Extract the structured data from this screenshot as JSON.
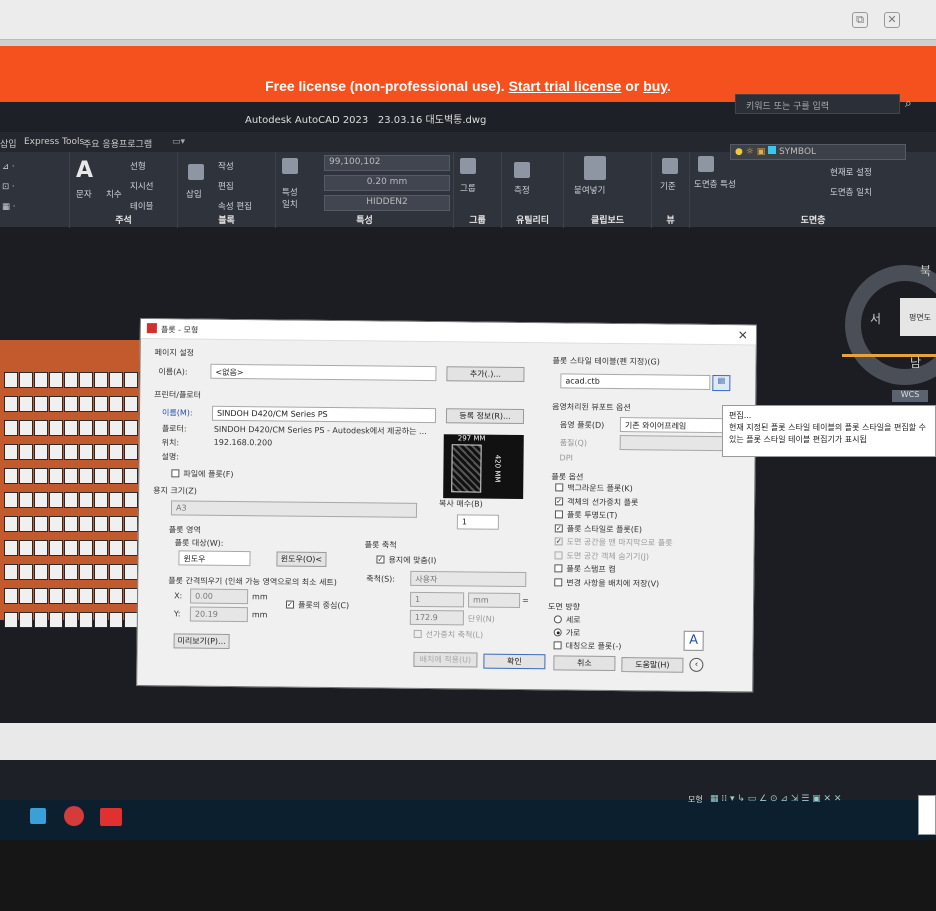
{
  "banner": {
    "prefix": "Free license (non-professional use). ",
    "trial": "Start trial license",
    "or": " or ",
    "buy": "buy",
    "suffix": "."
  },
  "app": {
    "title": "Autodesk AutoCAD 2023",
    "file": "23.03.16 대도벽통.dwg",
    "search_placeholder": "키워드 또는 구를 입력"
  },
  "ribbon_tabs": [
    "삽입",
    "Express Tools",
    "주요 응용프로그램"
  ],
  "ribbon": {
    "annotate_label": "주석",
    "annotate_items": [
      "문자",
      "치수",
      "선형",
      "지시선",
      "테이블"
    ],
    "block_label": "블록",
    "block_items": [
      "삽입",
      "작성",
      "편집",
      "속성 편집"
    ],
    "properties_label": "특성",
    "prop_color": "99,100,102",
    "prop_lineweight": "0.20 mm",
    "prop_linetype": "HIDDEN2",
    "prop_items": [
      "특성",
      "일치"
    ],
    "group_label": "그룹",
    "group_item": "그룹",
    "utility_label": "유틸리티",
    "utility_item": "측정",
    "clipboard_label": "클립보드",
    "clipboard_item": "붙여넣기",
    "view_label": "뷰",
    "view_item": "기준",
    "layer_label": "도면층",
    "layer_name": "SYMBOL",
    "layer_items": [
      "도면층 특성",
      "현재로 설정",
      "도면층 일치"
    ]
  },
  "viewcube": {
    "west": "서",
    "south": "남",
    "north": "북",
    "face": "평면도",
    "wcs": "WCS"
  },
  "status_right": "모형",
  "dialog": {
    "title": "플롯 - 모형",
    "page_setup": {
      "section": "페이지 설정",
      "name_label": "이름(A):",
      "name_value": "<없음>",
      "add_button": "추가(.)..."
    },
    "printer": {
      "section": "프린터/플로터",
      "name_label": "이름(M):",
      "name_value": "SINDOH D420/CM Series PS",
      "properties_button": "등록 정보(R)...",
      "plotter_label": "플로터:",
      "plotter_value": "SINDOH D420/CM Series PS - Autodesk에서 제공하는 ...",
      "where_label": "위치:",
      "where_value": "192.168.0.200",
      "desc_label": "설명:",
      "plot_to_file": "파일에 플롯(F)",
      "preview_width": "297 MM",
      "preview_height": "420 MM"
    },
    "paper": {
      "section": "용지 크기(Z)",
      "value": "A3"
    },
    "copies": {
      "label": "복사 매수(B)",
      "value": "1"
    },
    "area": {
      "section": "플롯 영역",
      "what_label": "플롯 대상(W):",
      "what_value": "윈도우",
      "window_button": "윈도우(O)<"
    },
    "offset": {
      "section": "플롯 간격띄우기 (인쇄 가능 영역으로의 최소 세트)",
      "x_label": "X:",
      "x_value": "0.00",
      "x_unit": "mm",
      "y_label": "Y:",
      "y_value": "20.19",
      "y_unit": "mm",
      "center": "플롯의 중심(C)"
    },
    "scale": {
      "section": "플롯 축척",
      "fit": "용지에 맞춤(I)",
      "scale_label": "축척(S):",
      "scale_value": "사용자",
      "v1": "1",
      "unit": "mm",
      "eq": "=",
      "v2": "172.9",
      "unit2": "단위(N)",
      "lw": "선가중치 축척(L)"
    },
    "plot_style": {
      "section": "플롯 스타일 테이블(펜 지정)(G)",
      "value": "acad.ctb"
    },
    "shaded": {
      "section": "음영처리된 뷰포트 옵션",
      "shade_label": "음영 플롯(D)",
      "shade_value": "기존 와이어프레임",
      "quality_label": "품질(Q)",
      "dpi_label": "DPI"
    },
    "options": {
      "section": "플롯 옵션",
      "items": [
        "백그라운드 플롯(K)",
        "객체의 선가중치 플롯",
        "플롯 투명도(T)",
        "플롯 스타일로 플롯(E)",
        "도면 공간을 맨 마지막으로 플롯",
        "도면 공간 객체 숨기기(J)",
        "플롯 스탬프 켬",
        "변경 사항을 배치에 저장(V)"
      ],
      "checked": [
        false,
        true,
        false,
        true,
        true,
        false,
        false,
        false
      ]
    },
    "orientation": {
      "section": "도면 방향",
      "portrait": "세로",
      "landscape": "가로",
      "upside": "대칭으로 플롯(-)"
    },
    "buttons": {
      "preview": "미리보기(P)...",
      "apply": "배치에 적용(U)",
      "ok": "확인",
      "cancel": "취소",
      "help": "도움말(H)"
    }
  },
  "tooltip": {
    "title": "편집...",
    "body": "현재 지정된 플롯 스타일 테이블의 플롯 스타일을 편집할 수 있는 플롯 스타일 테이블 편집기가 표시됩"
  }
}
